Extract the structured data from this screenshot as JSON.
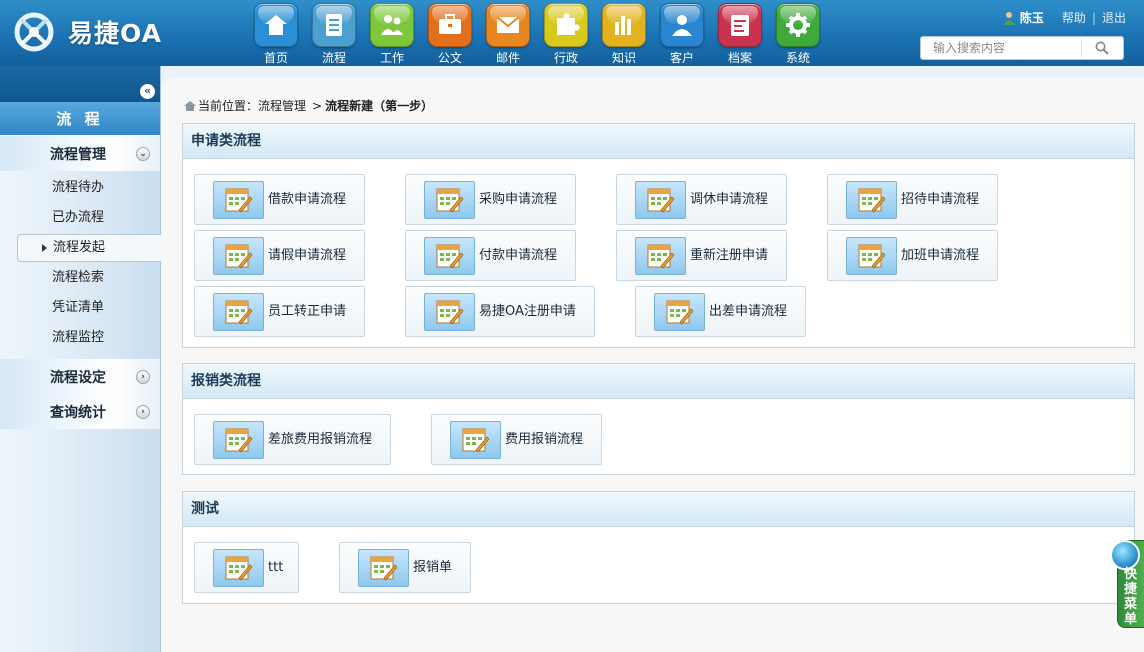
{
  "app": {
    "logo_text": "易捷OA"
  },
  "topnav": [
    {
      "label": "首页",
      "icon": "home-icon",
      "color": "#2b8fd6"
    },
    {
      "label": "流程",
      "icon": "flow-icon",
      "color": "#4aa0cf"
    },
    {
      "label": "工作",
      "icon": "work-icon",
      "color": "#7cc83a"
    },
    {
      "label": "公文",
      "icon": "briefcase-icon",
      "color": "#e36f1c"
    },
    {
      "label": "邮件",
      "icon": "mail-icon",
      "color": "#e8861f"
    },
    {
      "label": "行政",
      "icon": "puzzle-icon",
      "color": "#d9c91c"
    },
    {
      "label": "知识",
      "icon": "chart-icon",
      "color": "#e3b21f"
    },
    {
      "label": "客户",
      "icon": "user-icon",
      "color": "#2a86d0"
    },
    {
      "label": "档案",
      "icon": "archive-icon",
      "color": "#c9334d"
    },
    {
      "label": "系统",
      "icon": "gear-icon",
      "color": "#3fa93a"
    }
  ],
  "userbar": {
    "username": "陈玉",
    "help": "帮助",
    "separator": "|",
    "logout": "退出"
  },
  "search": {
    "placeholder": "输入搜索内容"
  },
  "sidebar": {
    "title": "流 程",
    "groups": [
      {
        "label": "流程管理",
        "expanded": true,
        "items": [
          {
            "label": "流程待办"
          },
          {
            "label": "已办流程"
          },
          {
            "label": "流程发起",
            "active": true
          },
          {
            "label": "流程检索"
          },
          {
            "label": "凭证清单"
          },
          {
            "label": "流程监控"
          }
        ]
      },
      {
        "label": "流程设定",
        "expanded": false
      },
      {
        "label": "查询统计",
        "expanded": false
      }
    ]
  },
  "breadcrumb": {
    "prefix": "当前位置：流程管理",
    "arrow": ">",
    "current": "流程新建（第一步）"
  },
  "panels": [
    {
      "title": "申请类流程",
      "items": [
        "借款申请流程",
        "采购申请流程",
        "调休申请流程",
        "招待申请流程",
        "请假申请流程",
        "付款申请流程",
        "重新注册申请",
        "加班申请流程",
        "员工转正申请",
        "易捷OA注册申请",
        "出差申请流程"
      ]
    },
    {
      "title": "报销类流程",
      "items": [
        "差旅费用报销流程",
        "费用报销流程"
      ]
    },
    {
      "title": "测试",
      "items": [
        "ttt",
        "报销单"
      ]
    }
  ],
  "quick_menu": {
    "label": "快捷菜单"
  }
}
